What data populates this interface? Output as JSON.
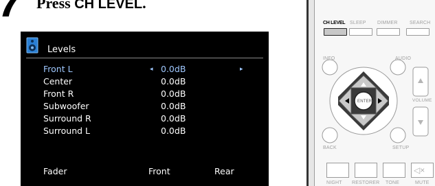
{
  "step": {
    "number": "7",
    "prefix": "Press ",
    "key": "CH LEVEL",
    "suffix": "."
  },
  "screen": {
    "title": "Levels",
    "icon": "speaker-icon",
    "rows": [
      {
        "name": "Front L",
        "value": "0.0dB",
        "left_arrow": "◂",
        "right_arrow": "▸"
      },
      {
        "name": "Center",
        "value": "0.0dB"
      },
      {
        "name": "Front R",
        "value": "0.0dB"
      },
      {
        "name": "Subwoofer",
        "value": "0.0dB"
      },
      {
        "name": "Surround R",
        "value": "0.0dB"
      },
      {
        "name": "Surround L",
        "value": "0.0dB"
      }
    ],
    "fader": {
      "label": "Fader",
      "option1": "Front",
      "option2": "Rear"
    }
  },
  "remote": {
    "top_buttons": [
      "CH LEVEL",
      "SLEEP",
      "DIMMER",
      "SEARCH"
    ],
    "info_label": "INFO",
    "audio_label": "AUDIO",
    "enter_label": "ENTER",
    "volume_label": "VOLUME",
    "back_label": "BACK",
    "setup_label": "SETUP",
    "bottom_buttons": [
      "NIGHT",
      "RESTORER",
      "TONE",
      "MUTE"
    ],
    "mute_glyph": "🔇",
    "colors": {
      "dpad": "#3a3a3a",
      "highlight": "#000000",
      "inactive_text": "#a0a0a0"
    }
  }
}
